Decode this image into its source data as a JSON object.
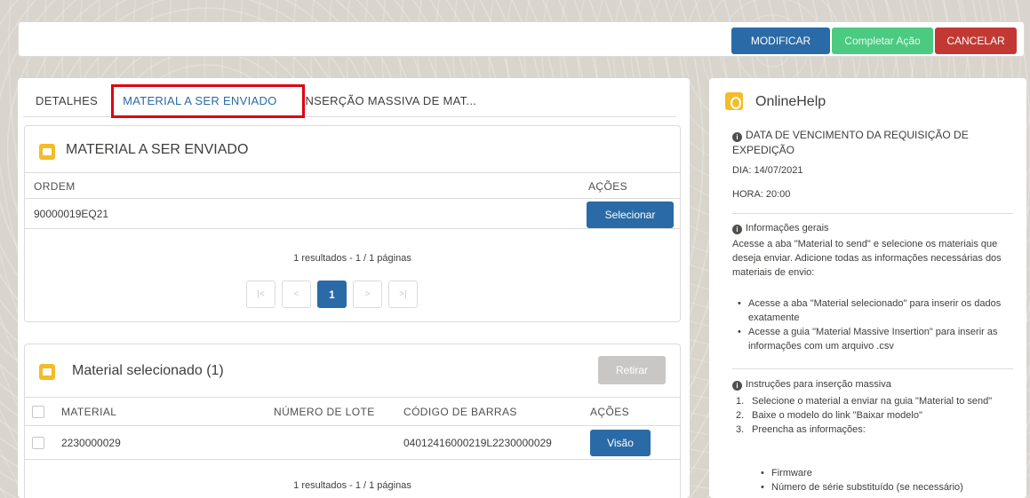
{
  "actions": {
    "modify": "MODIFICAR",
    "complete": "Completar Ação",
    "cancel": "CANCELAR"
  },
  "tabs": [
    {
      "label": "DETALHES"
    },
    {
      "label": "MATERIAL A SER ENVIADO"
    },
    {
      "label": "INSERÇÃO MASSIVA DE MAT..."
    }
  ],
  "card1": {
    "title": "MATERIAL A SER ENVIADO",
    "columns": {
      "order": "ORDEM",
      "actions": "AÇÕES"
    },
    "rows": [
      {
        "order": "90000019EQ21",
        "action": "Selecionar"
      }
    ],
    "results": "1 resultados - 1 / 1 páginas",
    "pager": {
      "first": "|<",
      "prev": "<",
      "current": "1",
      "next": ">",
      "last": ">|"
    }
  },
  "card2": {
    "title": "Material selecionado (1)",
    "remove_label": "Retirar",
    "columns": {
      "material": "MATERIAL",
      "lot": "NÚMERO DE LOTE",
      "barcode": "CÓDIGO DE BARRAS",
      "actions": "AÇÕES"
    },
    "rows": [
      {
        "material": "2230000029",
        "lot": "",
        "barcode": "04012416000219L2230000029",
        "action": "Visão"
      }
    ],
    "results": "1 resultados - 1 / 1 páginas"
  },
  "help": {
    "title": "OnlineHelp",
    "due_heading": "DATA DE VENCIMENTO DA REQUISIÇÃO DE EXPEDIÇÃO",
    "day": "DIA: 14/07/2021",
    "hour": "HORA: 20:00",
    "general_heading": "Informações gerais",
    "general_text": "Acesse a aba \"Material to send\" e selecione os materiais que deseja enviar. Adicione todas as informações necessárias dos materiais de envio:",
    "general_bullets": [
      "Acesse a aba \"Material selecionado\" para inserir os dados exatamente",
      "Acesse a guia \"Material Massive Insertion\" para inserir as informações com um arquivo .csv"
    ],
    "mass_heading": "Instruções para inserção massiva",
    "mass_steps": [
      {
        "num": "1.",
        "text": "Selecione o material a enviar na guia \"Material to send\""
      },
      {
        "num": "2.",
        "text": "Baixe o modelo do link \"Baixar modelo\""
      },
      {
        "num": "3.",
        "text": "Preencha as informações:"
      }
    ],
    "mass_sub_bullets": [
      "Firmware",
      "Número de série substituído (se necessário)"
    ]
  },
  "colors": {
    "primary": "#2a6aa6",
    "success": "#4bca81",
    "danger": "#c23934",
    "highlight": "#e00010",
    "icon_yellow": "#f4bc25"
  }
}
